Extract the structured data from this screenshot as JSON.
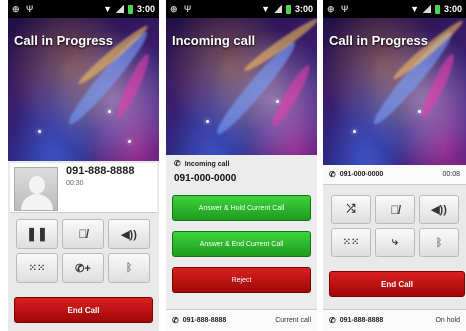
{
  "status_bar": {
    "time": "3:00"
  },
  "screen1": {
    "title": "Call in Progress",
    "contact_number": "091-888-8888",
    "duration": "00:30",
    "buttons": [
      "pause-icon",
      "mute-mic-icon",
      "speaker-icon",
      "dialpad-icon",
      "add-call-icon",
      "bluetooth-icon"
    ],
    "end_call": "End Call"
  },
  "screen2": {
    "title": "Incoming call",
    "incoming_label": "Incoming call",
    "incoming_number": "091-000-0000",
    "answer_hold": "Answer & Hold Current Call",
    "answer_end": "Answer & End Current Call",
    "reject": "Reject",
    "current_number": "091-888-8888",
    "current_status": "Current call"
  },
  "screen3": {
    "title": "Call in Progress",
    "call_number": "091-000-0000",
    "call_time": "00:08",
    "buttons": [
      "swap-calls-icon",
      "mute-mic-icon",
      "speaker-icon",
      "dialpad-icon",
      "merge-calls-icon",
      "bluetooth-icon"
    ],
    "end_call": "End Call",
    "hold_number": "091-888-8888",
    "hold_status": "On hold"
  },
  "colors": {
    "green": "#2bb82b",
    "red": "#c01010"
  }
}
